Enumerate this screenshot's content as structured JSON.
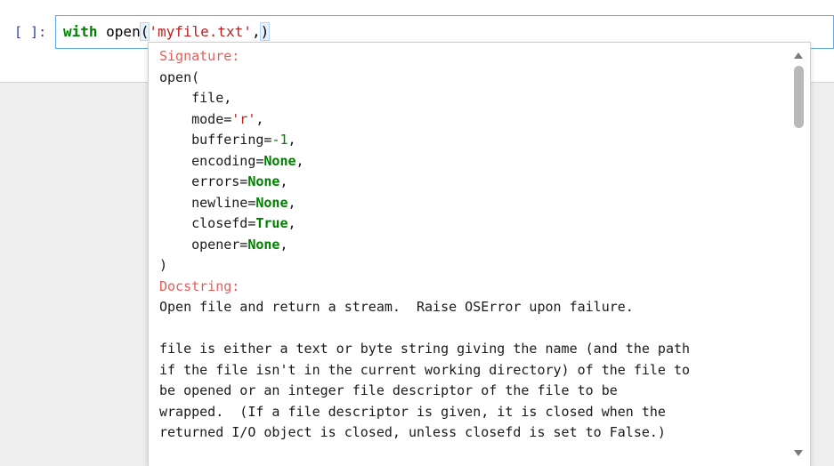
{
  "cell": {
    "prompt": "[ ]:",
    "code": {
      "keyword": "with",
      "func": " open",
      "open_paren": "(",
      "string": "'myfile.txt'",
      "comma": ",",
      "close_paren": ")"
    }
  },
  "tooltip": {
    "signature_heading": "Signature:",
    "sig_open": "open(",
    "params": [
      {
        "name": "file",
        "value": ""
      },
      {
        "name": "mode=",
        "value": "'r'",
        "kind": "string"
      },
      {
        "name": "buffering=",
        "value": "-1",
        "kind": "number"
      },
      {
        "name": "encoding=",
        "value": "None",
        "kind": "const"
      },
      {
        "name": "errors=",
        "value": "None",
        "kind": "const"
      },
      {
        "name": "newline=",
        "value": "None",
        "kind": "const"
      },
      {
        "name": "closefd=",
        "value": "True",
        "kind": "const"
      },
      {
        "name": "opener=",
        "value": "None",
        "kind": "const"
      }
    ],
    "sig_close": ")",
    "docstring_heading": "Docstring:",
    "doc_lines": [
      "Open file and return a stream.  Raise OSError upon failure.",
      "",
      "file is either a text or byte string giving the name (and the path",
      "if the file isn't in the current working directory) of the file to",
      "be opened or an integer file descriptor of the file to be",
      "wrapped.  (If a file descriptor is given, it is closed when the",
      "returned I/O object is closed, unless closefd is set to False.)"
    ]
  },
  "icons": {
    "scroll_up": "triangle-up-icon",
    "scroll_down": "triangle-down-icon"
  },
  "colors": {
    "keyword": "#008000",
    "string": "#ba2121",
    "heading": "#e75c58",
    "prompt": "#303f9f",
    "cell_border": "#64a8f0"
  }
}
